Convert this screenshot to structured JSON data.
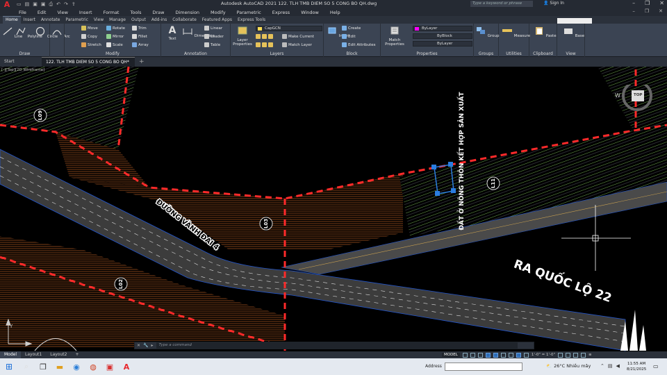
{
  "window": {
    "title": "Autodesk AutoCAD 2021    122. TLH TMB DIEM SO 5 CONG BO QH.dwg",
    "search_placeholder": "Type a keyword or phrase",
    "signin_label": "Sign In"
  },
  "menu": [
    "File",
    "Edit",
    "View",
    "Insert",
    "Format",
    "Tools",
    "Draw",
    "Dimension",
    "Modify",
    "Parametric",
    "Express",
    "Window",
    "Help"
  ],
  "ribbon_tabs": [
    "Home",
    "Insert",
    "Annotate",
    "Parametric",
    "View",
    "Manage",
    "Output",
    "Add-ins",
    "Collaborate",
    "Featured Apps",
    "Express Tools"
  ],
  "ribbon": {
    "draw": {
      "title": "Draw",
      "tools": [
        "Line",
        "Polyline",
        "Circle",
        "Arc"
      ]
    },
    "modify": {
      "title": "Modify",
      "tools": [
        "Move",
        "Rotate",
        "Trim",
        "Copy",
        "Mirror",
        "Fillet",
        "Stretch",
        "Scale",
        "Array"
      ]
    },
    "annotation": {
      "title": "Annotation",
      "tools": [
        "Text",
        "Dimension",
        "Linear",
        "Leader",
        "Table"
      ]
    },
    "layers": {
      "title": "Layers",
      "layer_properties": "Layer Properties",
      "current_layer": "CapGCN",
      "make_current": "Make Current",
      "match_layer": "Match Layer"
    },
    "block": {
      "title": "Block",
      "insert": "Insert",
      "create": "Create",
      "edit": "Edit",
      "edit_attributes": "Edit Attributes"
    },
    "properties": {
      "title": "Properties",
      "match_properties": "Match Properties",
      "color": "ByLayer",
      "linetype": "ByBlock",
      "lineweight": "ByLayer"
    },
    "groups": {
      "title": "Groups",
      "group": "Group"
    },
    "utilities": {
      "title": "Utilities",
      "measure": "Measure"
    },
    "clipboard": {
      "title": "Clipboard",
      "paste": "Paste"
    },
    "view": {
      "title": "View",
      "base": "Base"
    }
  },
  "file_tabs": {
    "start": "Start",
    "active": "122. TLH TMB DIEM SO 5 CONG BO QH*"
  },
  "viewport_label": "[-][Top][2D Wireframe]",
  "drawing": {
    "labels": {
      "l09": "L09",
      "l03": "L03",
      "l02": "L02",
      "l11": "L11",
      "duong_vanh_dai": "ĐƯỜNG VÀNH ĐAI 4",
      "ra_quoc_lo": "RA QUỐC LỘ 22",
      "dat_o": "ĐẤT Ở NÔNG THÔN KẾT HỢP SẢN XUẤT"
    },
    "viewcube": {
      "top": "TOP",
      "west": "W"
    },
    "colors": {
      "dashed_boundary": "#ff2a2a",
      "road": "#4a4a4a",
      "hatch_green": "#7fbf5a",
      "hatch_orange": "#c86a2a",
      "selection": "#2b7de0"
    }
  },
  "command": {
    "placeholder": "Type a command"
  },
  "status": {
    "layout_tabs": [
      "Model",
      "Layout1",
      "Layout2"
    ],
    "model_label": "MODEL",
    "scale": "1'-0\" = 1'-0\""
  },
  "taskbar": {
    "address_label": "Address",
    "weather": "26°C  Nhiều mây",
    "time": "11:55 AM",
    "date": "8/21/2025"
  }
}
